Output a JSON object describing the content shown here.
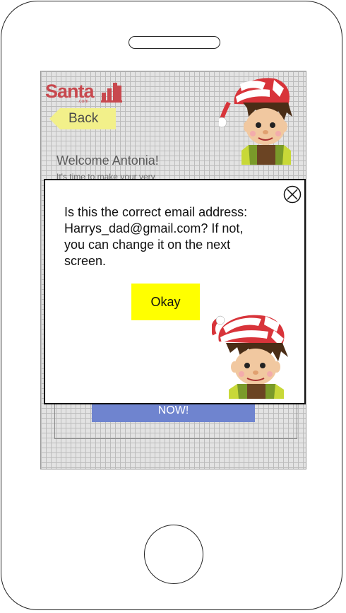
{
  "app": {
    "logo": {
      "text": "Santa",
      "suffix": ".com"
    },
    "back_label": "Back",
    "welcome": "Welcome Antonia!",
    "subtext": "It's time to make your very",
    "cta_label": "NOW!"
  },
  "modal": {
    "message_line1": "Is this the correct email address:",
    "message_line2": "Harrys_dad@gmail.com? If not,",
    "message_line3": "you can change it on the next",
    "message_line4": "screen.",
    "okay_label": "Okay"
  },
  "colors": {
    "brand": "#c8484e",
    "back_button": "#f2f08a",
    "cta": "#6f84cf",
    "okay_button": "#ffff00"
  },
  "icons": [
    "phone-speaker",
    "home-button",
    "logo-bars-icon",
    "close-icon",
    "elf-illustration"
  ]
}
